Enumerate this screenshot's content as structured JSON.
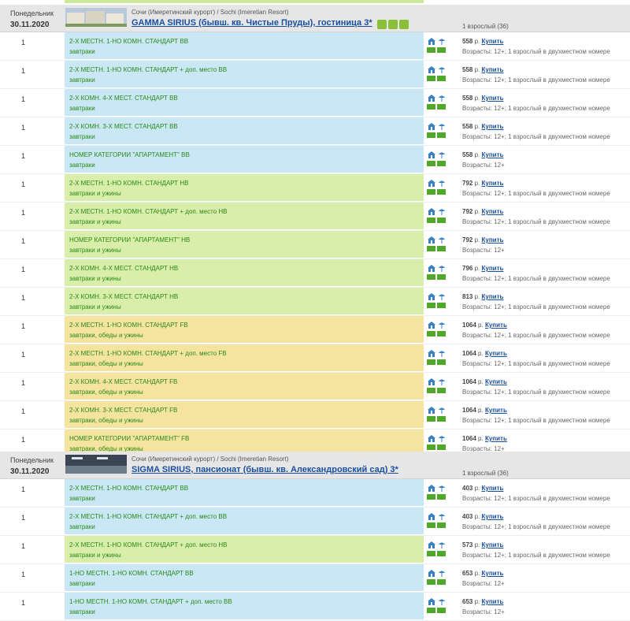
{
  "hotels": [
    {
      "day": "Понедельник",
      "date": "30.11.2020",
      "location": "Сочи (Имеретинский курорт) / Sochi (Imeretian Resort)",
      "name": "GAMMA SIRIUS (бывш. кв. Чистые Пруды), гостиница 3*",
      "pax": "1 взрослый (36)",
      "amenities": [
        "thumbs-up-icon",
        "family-icon",
        "leaf-icon"
      ],
      "rows": [
        {
          "qty": "1",
          "room": "2-Х МЕСТН. 1-НО КОМН. СТАНДАРТ BB",
          "meal": "завтраки",
          "price": "558",
          "currency": "р.",
          "buy": "Купить",
          "note": "Возрасты: 12+; 1 взрослый в двухместном номере",
          "type": "bb"
        },
        {
          "qty": "1",
          "room": "2-Х МЕСТН. 1-НО КОМН. СТАНДАРТ + доп. место BB",
          "meal": "завтраки",
          "price": "558",
          "currency": "р.",
          "buy": "Купить",
          "note": "Возрасты: 12+; 1 взрослый в двухместном номере",
          "type": "bb"
        },
        {
          "qty": "1",
          "room": "2-Х КОМН. 4-Х МЕСТ. СТАНДАРТ BB",
          "meal": "завтраки",
          "price": "558",
          "currency": "р.",
          "buy": "Купить",
          "note": "Возрасты: 12+; 1 взрослый в двухместном номере",
          "type": "bb"
        },
        {
          "qty": "1",
          "room": "2-Х КОМН. 3-Х МЕСТ. СТАНДАРТ BB",
          "meal": "завтраки",
          "price": "558",
          "currency": "р.",
          "buy": "Купить",
          "note": "Возрасты: 12+; 1 взрослый в двухместном номере",
          "type": "bb"
        },
        {
          "qty": "1",
          "room": "НОМЕР КАТЕГОРИИ \"АПАРТАМЕНТ\" BB",
          "meal": "завтраки",
          "price": "558",
          "currency": "р.",
          "buy": "Купить",
          "note": "Возрасты: 12+",
          "type": "bb"
        },
        {
          "qty": "1",
          "room": "2-Х МЕСТН. 1-НО КОМН. СТАНДАРТ HB",
          "meal": "завтраки и ужины",
          "price": "792",
          "currency": "р.",
          "buy": "Купить",
          "note": "Возрасты: 12+; 1 взрослый в двухместном номере",
          "type": "hb"
        },
        {
          "qty": "1",
          "room": "2-Х МЕСТН. 1-НО КОМН. СТАНДАРТ + доп. место HB",
          "meal": "завтраки и ужины",
          "price": "792",
          "currency": "р.",
          "buy": "Купить",
          "note": "Возрасты: 12+; 1 взрослый в двухместном номере",
          "type": "hb"
        },
        {
          "qty": "1",
          "room": "НОМЕР КАТЕГОРИИ \"АПАРТАМЕНТ\" HB",
          "meal": "завтраки и ужины",
          "price": "792",
          "currency": "р.",
          "buy": "Купить",
          "note": "Возрасты: 12+",
          "type": "hb"
        },
        {
          "qty": "1",
          "room": "2-Х КОМН. 4-Х МЕСТ. СТАНДАРТ HB",
          "meal": "завтраки и ужины",
          "price": "796",
          "currency": "р.",
          "buy": "Купить",
          "note": "Возрасты: 12+; 1 взрослый в двухместном номере",
          "type": "hb"
        },
        {
          "qty": "1",
          "room": "2-Х КОМН. 3-Х МЕСТ. СТАНДАРТ HB",
          "meal": "завтраки и ужины",
          "price": "813",
          "currency": "р.",
          "buy": "Купить",
          "note": "Возрасты: 12+; 1 взрослый в двухместном номере",
          "type": "hb"
        },
        {
          "qty": "1",
          "room": "2-Х МЕСТН. 1-НО КОМН. СТАНДАРТ FB",
          "meal": "завтраки, обеды и ужины",
          "price": "1064",
          "currency": "р.",
          "buy": "Купить",
          "note": "Возрасты: 12+; 1 взрослый в двухместном номере",
          "type": "fb"
        },
        {
          "qty": "1",
          "room": "2-Х МЕСТН. 1-НО КОМН. СТАНДАРТ + доп. место FB",
          "meal": "завтраки, обеды и ужины",
          "price": "1064",
          "currency": "р.",
          "buy": "Купить",
          "note": "Возрасты: 12+; 1 взрослый в двухместном номере",
          "type": "fb"
        },
        {
          "qty": "1",
          "room": "2-Х КОМН. 4-Х МЕСТ. СТАНДАРТ FB",
          "meal": "завтраки, обеды и ужины",
          "price": "1064",
          "currency": "р.",
          "buy": "Купить",
          "note": "Возрасты: 12+; 1 взрослый в двухместном номере",
          "type": "fb"
        },
        {
          "qty": "1",
          "room": "2-Х КОМН. 3-Х МЕСТ. СТАНДАРТ FB",
          "meal": "завтраки, обеды и ужины",
          "price": "1064",
          "currency": "р.",
          "buy": "Купить",
          "note": "Возрасты: 12+; 1 взрослый в двухместном номере",
          "type": "fb"
        },
        {
          "qty": "1",
          "room": "НОМЕР КАТЕГОРИИ \"АПАРТАМЕНТ\" FB",
          "meal": "завтраки, обеды и ужины",
          "price": "1064",
          "currency": "р.",
          "buy": "Купить",
          "note": "Возрасты: 12+",
          "type": "fb"
        }
      ]
    },
    {
      "day": "Понедельник",
      "date": "30.11.2020",
      "location": "Сочи (Имеретинский курорт) / Sochi (Imeretian Resort)",
      "name": "SIGMA SIRIUS, пансионат (бывш. кв. Александровский сад) 3*",
      "pax": "1 взрослый (36)",
      "amenities": [],
      "rows": [
        {
          "qty": "1",
          "room": "2-Х МЕСТН. 1-НО КОМН. СТАНДАРТ BB",
          "meal": "завтраки",
          "price": "403",
          "currency": "р.",
          "buy": "Купить",
          "note": "Возрасты: 12+; 1 взрослый в двухместном номере",
          "type": "bb"
        },
        {
          "qty": "1",
          "room": "2-Х МЕСТН. 1-НО КОМН. СТАНДАРТ + доп. место BB",
          "meal": "завтраки",
          "price": "403",
          "currency": "р.",
          "buy": "Купить",
          "note": "Возрасты: 12+; 1 взрослый в двухместном номере",
          "type": "bb"
        },
        {
          "qty": "1",
          "room": "2-Х МЕСТН. 1-НО КОМН. СТАНДАРТ + доп. место HB",
          "meal": "завтраки и ужины",
          "price": "573",
          "currency": "р.",
          "buy": "Купить",
          "note": "Возрасты: 12+; 1 взрослый в двухместном номере",
          "type": "hb"
        },
        {
          "qty": "1",
          "room": "1-НО МЕСТН. 1-НО КОМН. СТАНДАРТ BB",
          "meal": "завтраки",
          "price": "653",
          "currency": "р.",
          "buy": "Купить",
          "note": "Возрасты: 12+",
          "type": "bb"
        },
        {
          "qty": "1",
          "room": "1-НО МЕСТН. 1-НО КОМН. СТАНДАРТ + доп. место BB",
          "meal": "завтраки",
          "price": "653",
          "currency": "р.",
          "buy": "Купить",
          "note": "Возрасты: 12+",
          "type": "bb"
        }
      ]
    }
  ]
}
